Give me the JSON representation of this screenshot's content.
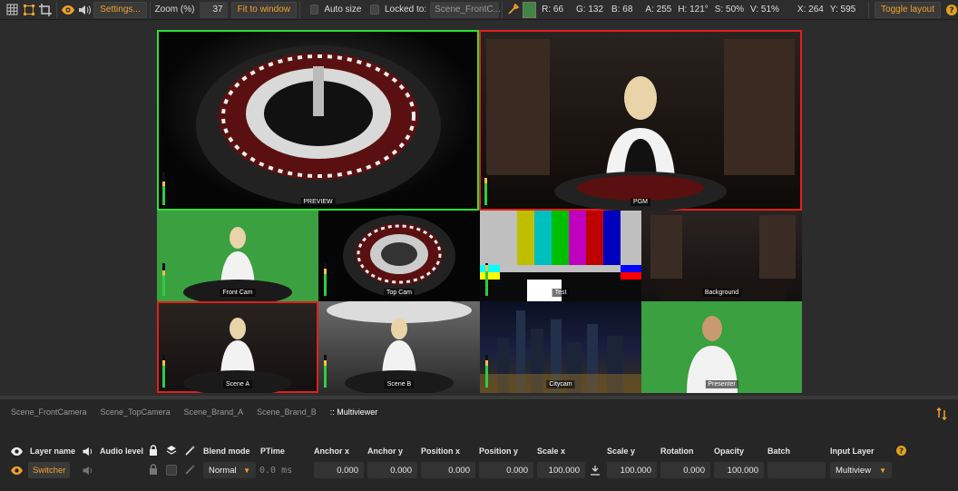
{
  "toolbar": {
    "settings_label": "Settings...",
    "zoom_label": "Zoom (%)",
    "zoom_value": "37",
    "fit_label": "Fit to window",
    "autosize_label": "Auto size",
    "locked_label": "Locked to:",
    "locked_value": "Scene_FrontC...",
    "color_swatch": "#428444",
    "r": "R: 66",
    "g": "G: 132",
    "b": "B: 68",
    "a": "A: 255",
    "h": "H: 121°",
    "s": "S: 50%",
    "v": "V: 51%",
    "x": "X: 264",
    "y": "Y: 595",
    "toggle_layout_label": "Toggle layout"
  },
  "multiview": {
    "preview_label": "PREVIEW",
    "program_label": "PGM",
    "tiles": [
      {
        "label": "Front Cam"
      },
      {
        "label": "Top Cam"
      },
      {
        "label": "Test"
      },
      {
        "label": "Background"
      },
      {
        "label": "Scene A"
      },
      {
        "label": "Scene B"
      },
      {
        "label": "Citycam"
      },
      {
        "label": "Presenter"
      }
    ]
  },
  "tabs": [
    "Scene_FrontCamera",
    "Scene_TopCamera",
    "Scene_Brand_A",
    "Scene_Brand_B",
    ":: Multiviewer"
  ],
  "props": {
    "headers": {
      "layer_name": "Layer name",
      "audio_level": "Audio level",
      "blend_mode": "Blend mode",
      "ptime": "PTime",
      "anchor_x": "Anchor x",
      "anchor_y": "Anchor y",
      "position_x": "Position x",
      "position_y": "Position y",
      "scale_x": "Scale x",
      "scale_y": "Scale y",
      "rotation": "Rotation",
      "opacity": "Opacity",
      "batch": "Batch",
      "input_layer": "Input Layer"
    },
    "values": {
      "layer_name": "Switcher",
      "blend_mode": "Normal",
      "ptime": "0.0 ms",
      "anchor_x": "0.000",
      "anchor_y": "0.000",
      "position_x": "0.000",
      "position_y": "0.000",
      "scale_x": "100.000",
      "scale_y": "100.000",
      "rotation": "0.000",
      "opacity": "100.000",
      "batch": "",
      "input_layer": "Multiview"
    }
  },
  "colors": {
    "accent": "#f0a030",
    "preview_border": "#2ee03a",
    "program_border": "#e02020"
  }
}
